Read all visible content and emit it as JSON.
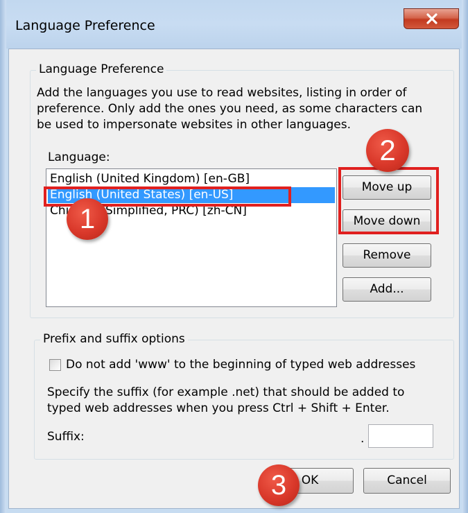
{
  "window": {
    "title": "Language Preference",
    "close_glyph": "x"
  },
  "language_group": {
    "legend": "Language Preference",
    "description_lines": [
      "Add the languages you use to read websites, listing in order of",
      "preference. Only add the ones you need, as some characters can",
      "be used to impersonate websites in other languages."
    ],
    "list_label": "Language:",
    "languages": [
      {
        "label": "English (United Kingdom) [en-GB]",
        "selected": false
      },
      {
        "label": "English (United States) [en-US]",
        "selected": true
      },
      {
        "label": "Chinese (Simplified, PRC) [zh-CN]",
        "selected": false
      }
    ],
    "buttons": {
      "move_up": "Move up",
      "move_down": "Move down",
      "remove": "Remove",
      "add": "Add..."
    }
  },
  "prefix_group": {
    "legend": "Prefix and suffix options",
    "checkbox_label": "Do not add 'www' to the beginning of typed web addresses",
    "checkbox_checked": false,
    "description_lines": [
      "Specify the suffix (for example .net) that should be added to",
      "typed web addresses when you press Ctrl + Shift + Enter."
    ],
    "suffix_label": "Suffix:",
    "suffix_dot": ".",
    "suffix_value": ""
  },
  "footer": {
    "ok": "OK",
    "cancel": "Cancel"
  },
  "annotations": {
    "markers": [
      "1",
      "2",
      "3"
    ],
    "marker_color": "#d9382a",
    "highlight_color": "#e0201f"
  },
  "colors": {
    "selection": "#3399ff",
    "dialog_face": "#f0f0f0",
    "frame": "#c7dcf1"
  }
}
